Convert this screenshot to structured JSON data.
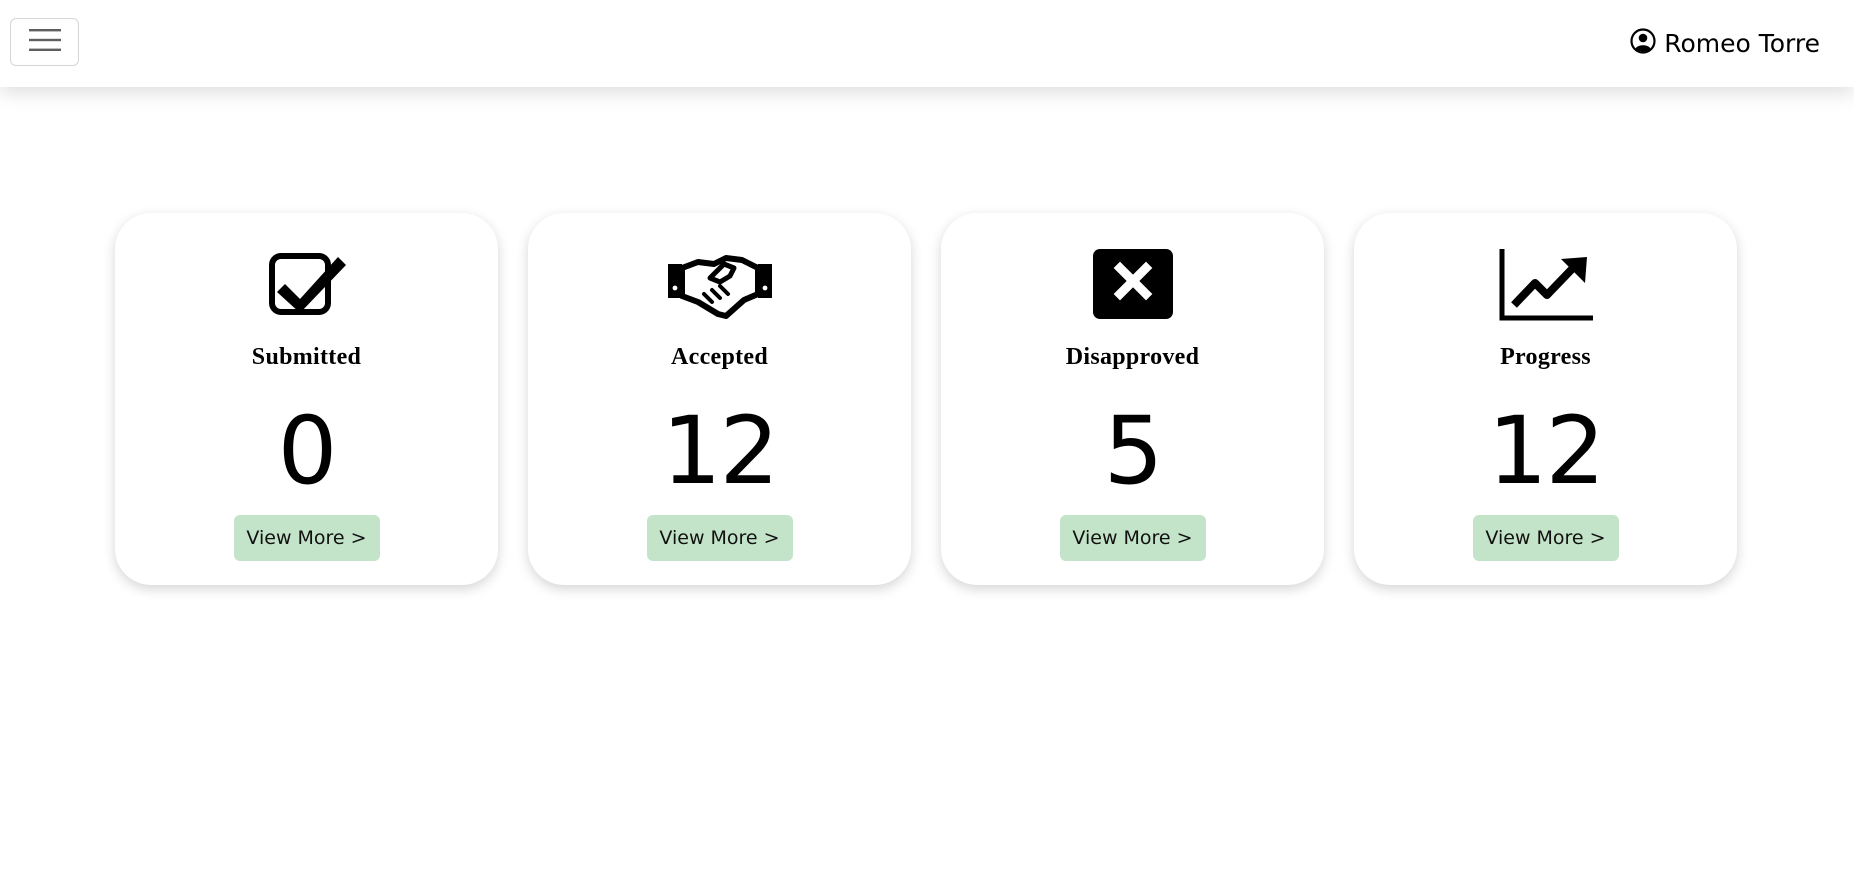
{
  "header": {
    "menu_icon": "hamburger-icon",
    "user_icon": "user-circle-icon",
    "user_name": "Romeo Torre"
  },
  "cards": [
    {
      "icon": "checkbox-check-icon",
      "title": "Submitted",
      "count": "0",
      "button_label": "View More >"
    },
    {
      "icon": "handshake-icon",
      "title": "Accepted",
      "count": "12",
      "button_label": "View More >"
    },
    {
      "icon": "x-square-icon",
      "title": "Disapproved",
      "count": "5",
      "button_label": "View More >"
    },
    {
      "icon": "chart-line-up-icon",
      "title": "Progress",
      "count": "12",
      "button_label": "View More >"
    }
  ],
  "colors": {
    "button_bg": "#c4e4c9",
    "card_bg": "#ffffff",
    "text": "#000000"
  }
}
